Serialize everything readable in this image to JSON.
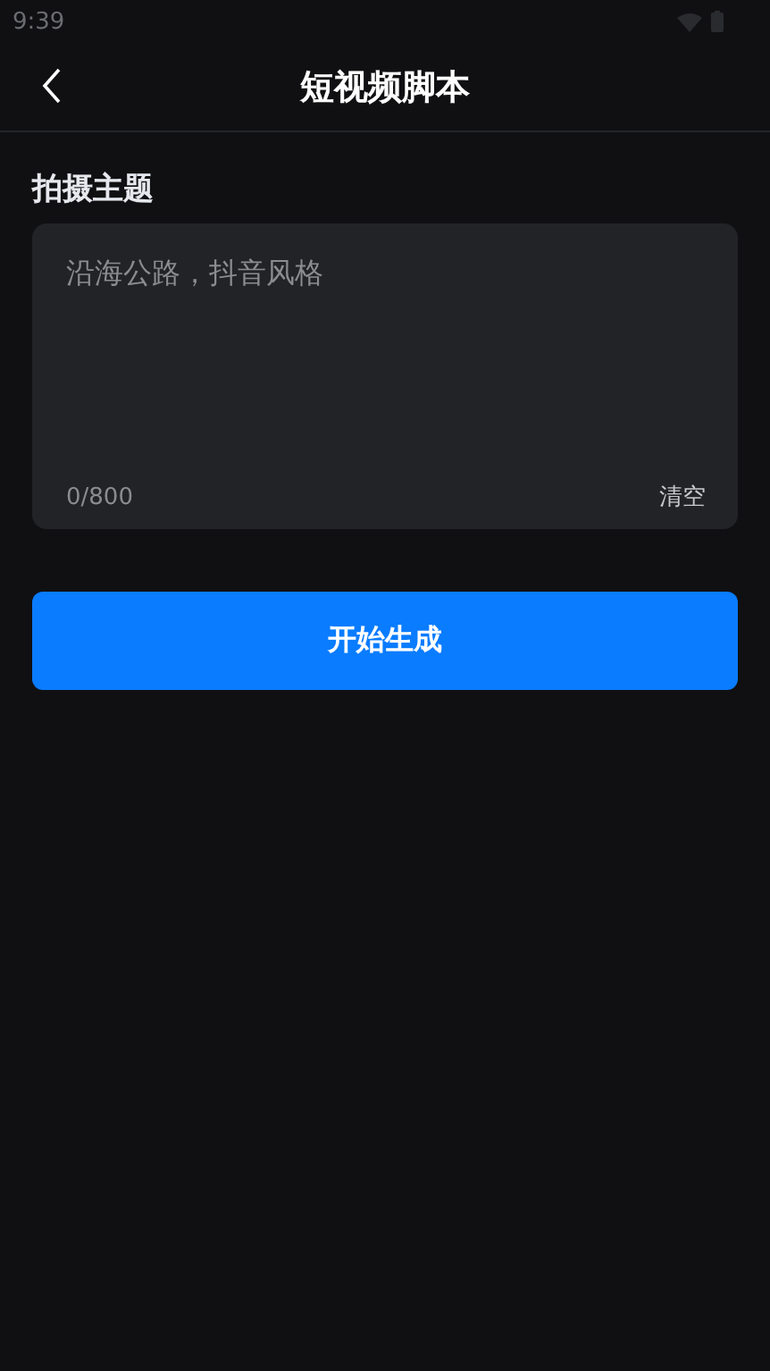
{
  "status_bar": {
    "time": "9:39"
  },
  "header": {
    "title": "短视频脚本"
  },
  "form": {
    "label": "拍摄主题",
    "placeholder": "沿海公路，抖音风格",
    "counter": "0/800",
    "clear": "清空"
  },
  "submit": {
    "label": "开始生成"
  }
}
